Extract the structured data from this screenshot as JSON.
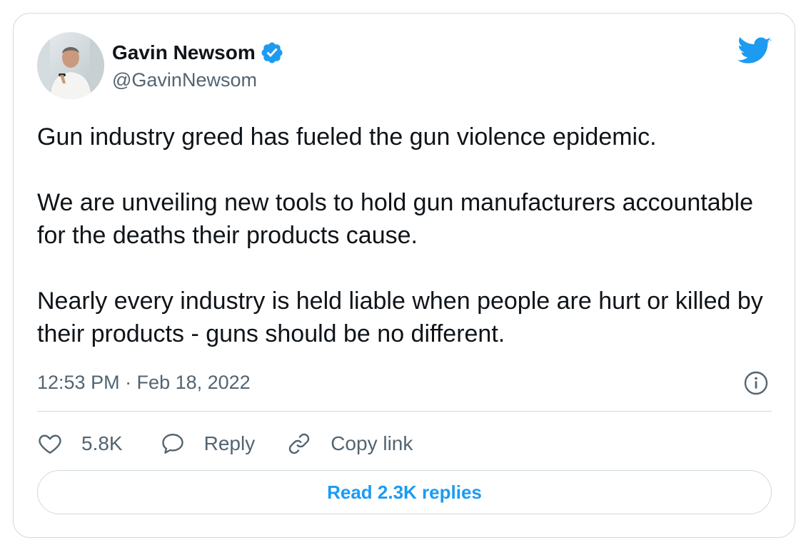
{
  "author": {
    "name": "Gavin Newsom",
    "handle": "@GavinNewsom",
    "verified": true
  },
  "tweet": {
    "paragraphs": [
      "Gun industry greed has fueled the gun violence epidemic.",
      "We are unveiling new tools to hold gun manufacturers accountable for the deaths their products cause.",
      "Nearly every industry is held liable when people are hurt or killed by their products - guns should be no different."
    ],
    "timestamp": "12:53 PM · Feb 18, 2022"
  },
  "actions": {
    "like_count": "5.8K",
    "reply_label": "Reply",
    "copy_link_label": "Copy link"
  },
  "read_replies_label": "Read 2.3K replies",
  "icons": {
    "brand": "twitter-bird-icon",
    "verified": "verified-badge-icon",
    "info": "info-icon",
    "like": "heart-icon",
    "reply": "speech-bubble-icon",
    "copy_link": "link-icon"
  },
  "colors": {
    "accent": "#1d9bf0",
    "text_primary": "#0f1419",
    "text_secondary": "#536471",
    "border": "#cfd9de"
  }
}
